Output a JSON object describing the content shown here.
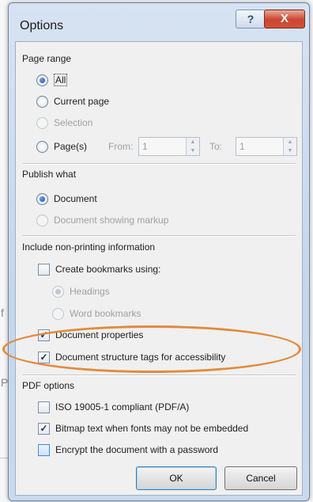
{
  "background": {
    "left_fragments": [
      "f",
      "P"
    ]
  },
  "dialog": {
    "title": "Options",
    "help_label": "?",
    "close_label": "X",
    "page_range": {
      "label": "Page range",
      "options": [
        {
          "label": "All",
          "selected": true,
          "disabled": false
        },
        {
          "label": "Current page",
          "selected": false,
          "disabled": false
        },
        {
          "label": "Selection",
          "selected": false,
          "disabled": true
        },
        {
          "label": "Page(s)",
          "selected": false,
          "disabled": false
        }
      ],
      "from_label": "From:",
      "from_value": "1",
      "to_label": "To:",
      "to_value": "1"
    },
    "publish_what": {
      "label": "Publish what",
      "options": [
        {
          "label": "Document",
          "selected": true,
          "disabled": false
        },
        {
          "label": "Document showing markup",
          "selected": false,
          "disabled": true
        }
      ]
    },
    "non_printing": {
      "label": "Include non-printing information",
      "create_bookmarks": {
        "label": "Create bookmarks using:",
        "checked": false
      },
      "bookmark_options": [
        {
          "label": "Headings",
          "selected": true,
          "disabled": true
        },
        {
          "label": "Word bookmarks",
          "selected": false,
          "disabled": true
        }
      ],
      "document_properties": {
        "label": "Document properties",
        "checked": true
      },
      "structure_tags": {
        "label": "Document structure tags for accessibility",
        "checked": true
      }
    },
    "pdf_options": {
      "label": "PDF options",
      "iso": {
        "label": "ISO 19005-1 compliant (PDF/A)",
        "checked": false
      },
      "bitmap": {
        "label": "Bitmap text when fonts may not be embedded",
        "checked": true
      },
      "encrypt": {
        "label": "Encrypt the document with a password",
        "checked": false
      }
    },
    "ok_label": "OK",
    "cancel_label": "Cancel"
  },
  "annotation": {
    "color": "#e38a3c"
  },
  "check_mark": "✓"
}
